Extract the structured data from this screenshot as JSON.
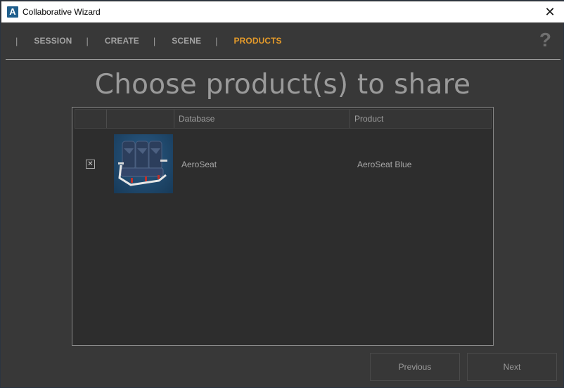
{
  "window": {
    "title": "Collaborative Wizard",
    "app_icon": "A",
    "close_glyph": "✕"
  },
  "nav": {
    "separator": "|",
    "items": [
      {
        "label": "SESSION",
        "active": false
      },
      {
        "label": "CREATE",
        "active": false
      },
      {
        "label": "SCENE",
        "active": false
      },
      {
        "label": "PRODUCTS",
        "active": true
      }
    ],
    "help_glyph": "?",
    "active_color": "#e49a2a"
  },
  "heading": "Choose product(s) to share",
  "table": {
    "columns": [
      "",
      "",
      "Database",
      "Product"
    ],
    "rows": [
      {
        "checked": true,
        "check_glyph": "✕",
        "thumbnail": "aeroseat-thumbnail",
        "database": "AeroSeat",
        "product": "AeroSeat Blue"
      }
    ]
  },
  "buttons": {
    "previous": "Previous",
    "next": "Next"
  }
}
